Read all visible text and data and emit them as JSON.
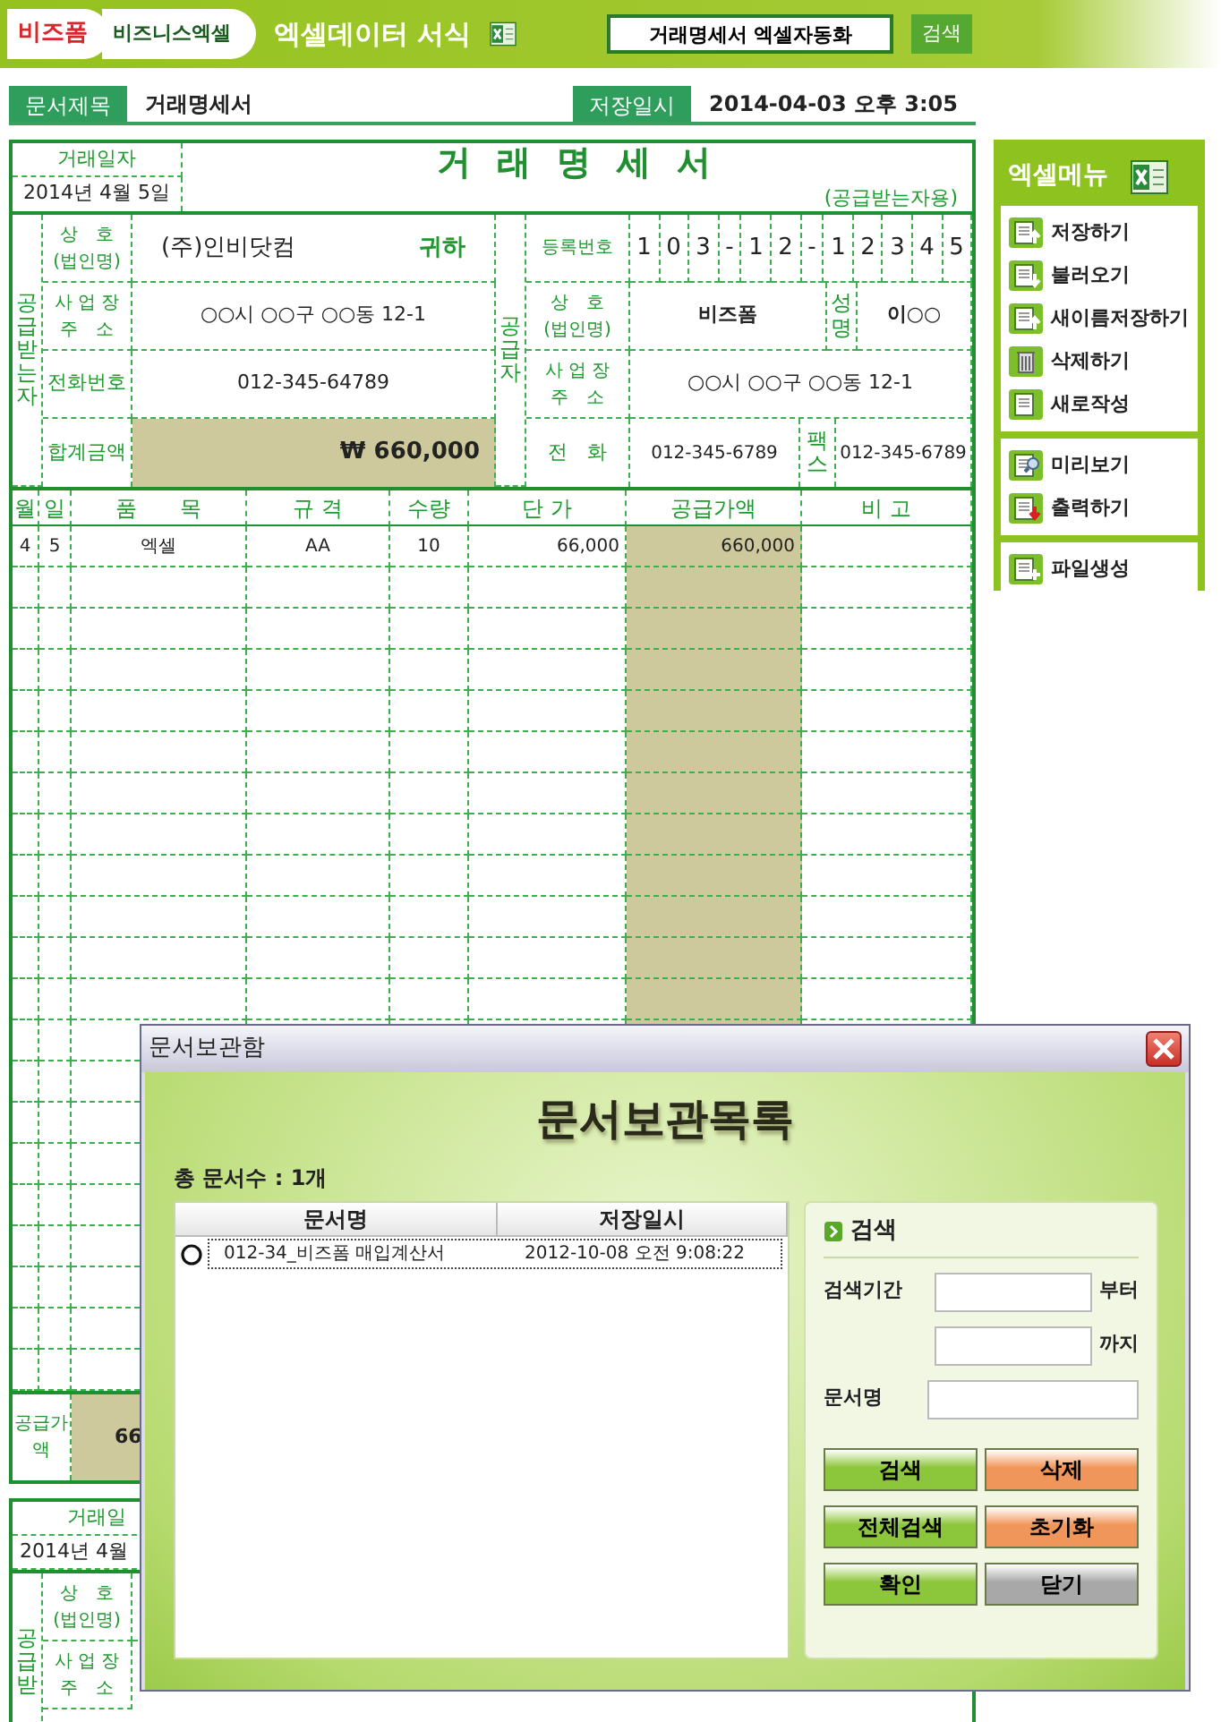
{
  "app_header": {
    "logo": "비즈폼",
    "sub_logo": "비즈니스엑셀",
    "title": "엑셀데이터 서식",
    "search": {
      "value": "거래명세서 엑셀자동화"
    },
    "search_button": "검색"
  },
  "doc_bar": {
    "title_label": "문서제목",
    "title_value": "거래명세서",
    "saved_label": "저장일시",
    "saved_value": "2014-04-03 오후 3:05"
  },
  "invoice": {
    "date_label": "거래일자",
    "date": "2014년 4월 5일",
    "title": "거 래 명 세 서",
    "copy_note": "(공급받는자용)",
    "receiver": {
      "side_label": "공급받는자",
      "company_label": "상　호",
      "company_sub": "(법인명)",
      "company": "(주)인비닷컴",
      "honorific": "귀하",
      "address_label": "사 업 장",
      "address_sub": "주　소",
      "address": "○○시 ○○구 ○○동 12-1",
      "phone_label": "전화번호",
      "phone": "012-345-64789",
      "total_label": "합계금액",
      "total": "₩  660,000"
    },
    "supplier": {
      "side_label": "공급자",
      "reg_label": "등록번호",
      "reg_digits": [
        "1",
        "0",
        "3",
        "-",
        "1",
        "2",
        "-",
        "1",
        "2",
        "3",
        "4",
        "5"
      ],
      "company_label": "상　호",
      "company_sub": "(법인명)",
      "company": "비즈폼",
      "name_label": "성명",
      "name": "이○○",
      "address_label": "사 업 장",
      "address_sub": "주　소",
      "address": "○○시 ○○구 ○○동 12-1",
      "phone_label": "전　화",
      "phone": "012-345-6789",
      "fax_label": "팩스",
      "fax": "012-345-6789"
    },
    "columns": [
      "월",
      "일",
      "품　　목",
      "규 격",
      "수량",
      "단 가",
      "공급가액",
      "비 고"
    ],
    "rows": [
      [
        "4",
        "5",
        "엑셀",
        "AA",
        "10",
        "66,000",
        "660,000",
        ""
      ]
    ],
    "footer_label": "공급가액",
    "footer_value": "66"
  },
  "invoice_copy": {
    "date_label": "거래일",
    "date": "2014년 4월",
    "side_label": "공급받",
    "company_label": "상　호",
    "company_sub": "(법인명)",
    "address_label": "사 업 장",
    "address_sub": "주　소"
  },
  "excel_menu": {
    "title": "엑셀메뉴",
    "groups": [
      [
        "저장하기",
        "불러오기",
        "새이름저장하기",
        "삭제하기",
        "새로작성"
      ],
      [
        "미리보기",
        "출력하기"
      ],
      [
        "파일생성"
      ]
    ]
  },
  "dialog": {
    "title": "문서보관함",
    "heading": "문서보관목록",
    "count": "총 문서수 : 1개",
    "columns": [
      "문서명",
      "저장일시"
    ],
    "rows": [
      {
        "name": "012-34_비즈폼 매입계산서",
        "saved": "2012-10-08 오전 9:08:22",
        "selected": true,
        "checked": false
      }
    ],
    "search_title": "검색",
    "period_label": "검색기간",
    "from_label": "부터",
    "to_label": "까지",
    "name_label": "문서명",
    "buttons": [
      {
        "label": "검색",
        "color": "#8cc63a"
      },
      {
        "label": "삭제",
        "color": "#f0965a"
      },
      {
        "label": "전체검색",
        "color": "#8cc63a"
      },
      {
        "label": "초기화",
        "color": "#f0965a"
      },
      {
        "label": "확인",
        "color": "#8cc63a"
      },
      {
        "label": "닫기",
        "color": "#a8a8a8"
      }
    ]
  }
}
